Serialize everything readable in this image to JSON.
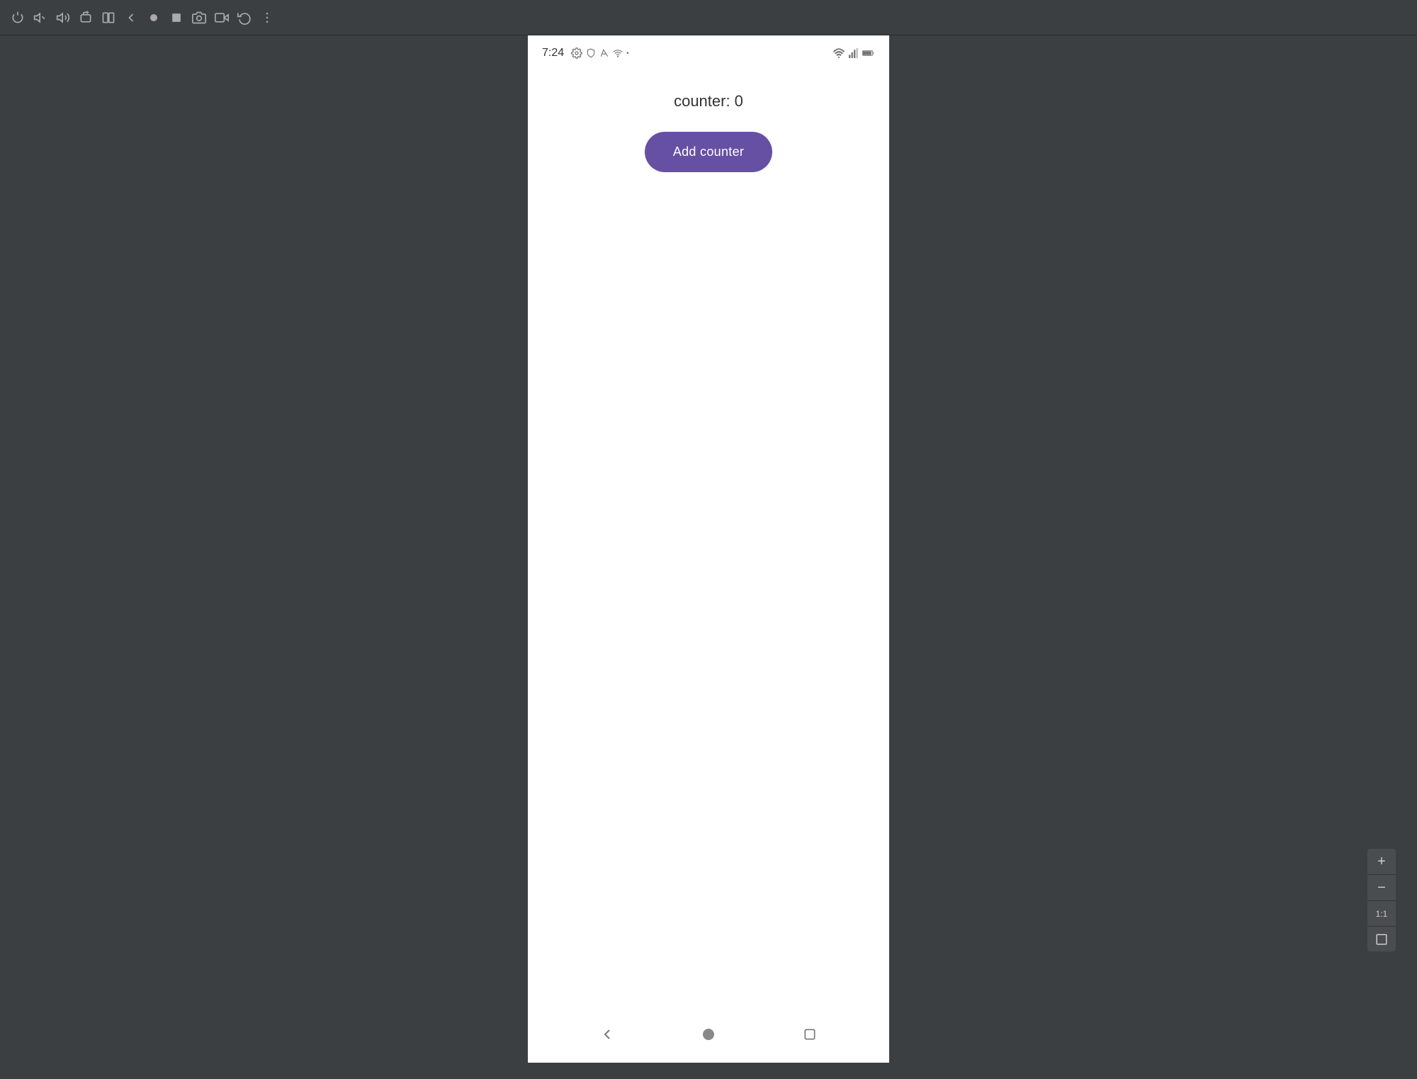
{
  "toolbar": {
    "icons": [
      {
        "name": "power-icon",
        "symbol": "⏻"
      },
      {
        "name": "volume-down-icon",
        "symbol": "🔉"
      },
      {
        "name": "volume-up-icon",
        "symbol": "🔊"
      },
      {
        "name": "rotate-icon",
        "symbol": "⟳"
      },
      {
        "name": "screen-icon",
        "symbol": "⬜"
      },
      {
        "name": "back-icon",
        "symbol": "◀"
      },
      {
        "name": "record-icon",
        "symbol": "⬤"
      },
      {
        "name": "stop-icon",
        "symbol": "■"
      },
      {
        "name": "camera-icon",
        "symbol": "📷"
      },
      {
        "name": "video-icon",
        "symbol": "📹"
      },
      {
        "name": "replay-icon",
        "symbol": "↺"
      },
      {
        "name": "more-icon",
        "symbol": "⋮"
      }
    ]
  },
  "status_bar": {
    "time": "7:24",
    "dot": "•"
  },
  "app": {
    "counter_label": "counter: 0",
    "counter_value": 0,
    "add_button_label": "Add counter"
  },
  "nav_bar": {
    "back_label": "◀",
    "home_label": "⬤",
    "recents_label": "■"
  },
  "zoom": {
    "plus": "+",
    "minus": "−",
    "ratio": "1:1"
  },
  "colors": {
    "background": "#3c3f41",
    "button_bg": "#6650a4",
    "phone_bg": "#ffffff",
    "text_primary": "#333333"
  }
}
